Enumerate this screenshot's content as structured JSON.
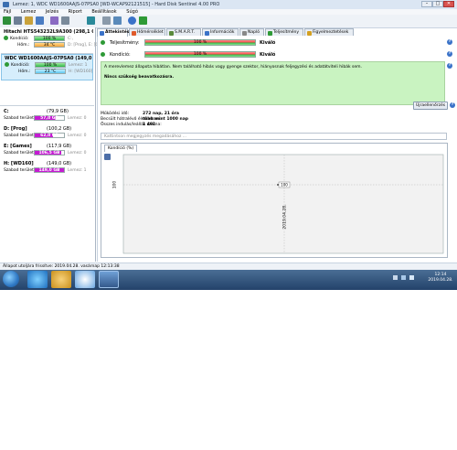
{
  "window": {
    "title": "Lemez: 1, WDC WD1600AAJS-07PSA0 [WD-WCAP92121515]  -  Hard Disk Sentinel 4.00 PRO",
    "minimize": "–",
    "maximize": "□",
    "close": "✕"
  },
  "menu": [
    "Fájl",
    "Lemez",
    "Jelzés",
    "Riport",
    "Beállítások",
    "Súgó"
  ],
  "toolbar": [
    "refresh-icon",
    "save-icon",
    "report-icon",
    "mail-icon",
    "test-icon",
    "disk-icon",
    "copy-icon",
    "settings-icon",
    "info-icon",
    "help-icon",
    "update-icon"
  ],
  "disks": [
    {
      "name": "Hitachi HTS543232L9A300 (298,1 GB)",
      "name_ext": "Lemez: 0",
      "health_label": "Kondíció:",
      "health_value": "100 %",
      "health_ext": "C:,",
      "temp_label": "Hőm.:",
      "temp_value": "34 °C",
      "temp_ext": "D: [Prog], E: [Ga...",
      "selected": false
    },
    {
      "name": "WDC WD1600AAJS-07PSA0 (149,0 GB)",
      "name_ext": "",
      "health_label": "Kondíció:",
      "health_value": "100 %",
      "health_ext": "Lemez: 1",
      "temp_label": "Hőm.:",
      "temp_value": "23 °C",
      "temp_ext": "H: [WD160]",
      "selected": true
    }
  ],
  "volumes": [
    {
      "name": "C:",
      "size": "(79,9 GB)",
      "free_label": "Szabad terület:",
      "free_value": "57,0 GB",
      "disk": "Lemez: 0",
      "fill": 0.71
    },
    {
      "name": "D: [Prog]",
      "size": "(100,2 GB)",
      "free_label": "Szabad terület:",
      "free_value": "62,0 GB",
      "disk": "Lemez: 0",
      "fill": 0.62
    },
    {
      "name": "E: [Games]",
      "size": "(117,9 GB)",
      "free_label": "Szabad terület:",
      "free_value": "106,5 GB",
      "disk": "Lemez: 0",
      "fill": 0.9
    },
    {
      "name": "H: [WD160]",
      "size": "(149,0 GB)",
      "free_label": "Szabad terület:",
      "free_value": "149,0 GB",
      "disk": "Lemez: 1",
      "fill": 1.0
    }
  ],
  "tabs": [
    {
      "label": "Áttekintés",
      "color": "#3a72c8",
      "active": true
    },
    {
      "label": "Hőmérséklet",
      "color": "#e05a2a",
      "active": false
    },
    {
      "label": "S.M.A.R.T.",
      "color": "#5a8a3a",
      "active": false
    },
    {
      "label": "Információk",
      "color": "#3a72c8",
      "active": false
    },
    {
      "label": "Napló",
      "color": "#888888",
      "active": false
    },
    {
      "label": "Teljesítmény",
      "color": "#2e9a36",
      "active": false
    },
    {
      "label": "Figyelmeztetések",
      "color": "#d4a020",
      "active": false
    }
  ],
  "overview": {
    "performance_label": "Teljesítmény:",
    "performance_value": "100 %",
    "performance_text": "Kiváló",
    "health_label": "Kondíció:",
    "health_value": "100 %",
    "health_text": "Kiváló",
    "note_line1": "A merevlemez állapota hibátlan. Nem található hibás vagy gyenge szektor, hiányosnak feljegyzési és adatátviteli hibák sem.",
    "note_line2": "Nincs szükség beavatkozásra.",
    "uptime_label": "Működési idő:",
    "uptime_value": "272 nap, 21 óra",
    "remaining_label": "Becsült hátralévő élettartam:",
    "remaining_value": "több mint 1000 nap",
    "starts_label": "Összes indulás/leállás száma:",
    "starts_value": "1 491",
    "recheck_button": "Újraellenőrzés",
    "comment_placeholder": "Kattintson megjegyzés megadásához ..."
  },
  "chart_data": {
    "type": "line",
    "tab_label": "Kondíció  (%)",
    "x": [
      "2019.04.28."
    ],
    "series": [
      {
        "values": [
          100
        ]
      }
    ],
    "ylabel_tick": "100",
    "point_label": "100"
  },
  "statusbar": "Állapot utoljára frissítve: 2019.04.28. vasárnap 12:13:38",
  "taskbar": {
    "time": "12:14",
    "date": "2019.04.28."
  },
  "colors": {
    "accent": "#3a72c8",
    "free_bar": "#c51bd2",
    "ok_green": "#2e9a36",
    "note_bg": "#c9f3c1"
  }
}
